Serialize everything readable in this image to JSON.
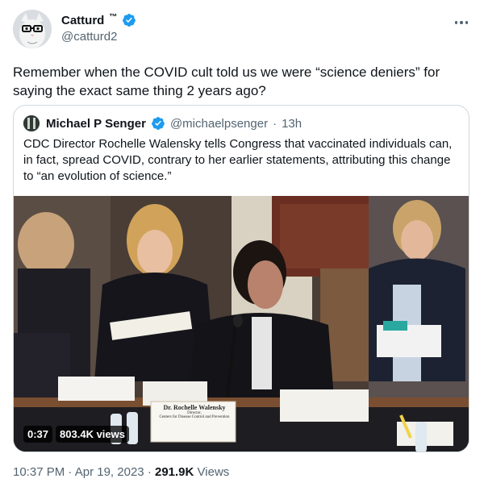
{
  "author": {
    "display_name": "Catturd",
    "tm": "™",
    "handle": "@catturd2",
    "verified": true
  },
  "tweet_text": "Remember when the COVID cult told us we were “science deniers” for saying the exact same thing 2 years ago?",
  "quote": {
    "display_name": "Michael P Senger",
    "handle": "@michaelpsenger",
    "separator": "·",
    "age": "13h",
    "text": "CDC Director Rochelle Walensky tells Congress that vaccinated individuals can, in fact, spread COVID, contrary to her earlier statements, attributing this change to “an evolution of science.”",
    "video": {
      "duration": "0:37",
      "views": "803.4K views",
      "nameplate_line1": "Dr. Rochelle Walensky",
      "nameplate_line2": "Director,",
      "nameplate_line3": "Centers for Disease Control and Prevention"
    }
  },
  "meta": {
    "time": "10:37 PM",
    "dot1": "·",
    "date": "Apr 19, 2023",
    "dot2": "·",
    "views_count": "291.9K",
    "views_label": "Views"
  },
  "colors": {
    "verified_blue": "#1d9bf0",
    "text_primary": "#0f1419",
    "text_secondary": "#536471",
    "border": "#cfd9de"
  }
}
